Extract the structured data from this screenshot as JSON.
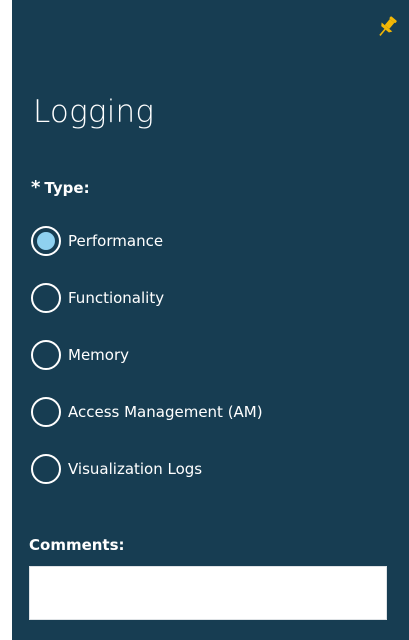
{
  "panel": {
    "title": "Logging",
    "pin_icon": "pin-icon",
    "accent_color": "#f2b705",
    "background_color": "#173d52"
  },
  "type_field": {
    "required_marker": "*",
    "label": "Type:",
    "selected": "Performance",
    "options": [
      {
        "label": "Performance",
        "checked": true
      },
      {
        "label": "Functionality",
        "checked": false
      },
      {
        "label": "Memory",
        "checked": false
      },
      {
        "label": "Access Management (AM)",
        "checked": false
      },
      {
        "label": "Visualization Logs",
        "checked": false
      }
    ]
  },
  "comments": {
    "label": "Comments:",
    "value": "",
    "placeholder": ""
  }
}
